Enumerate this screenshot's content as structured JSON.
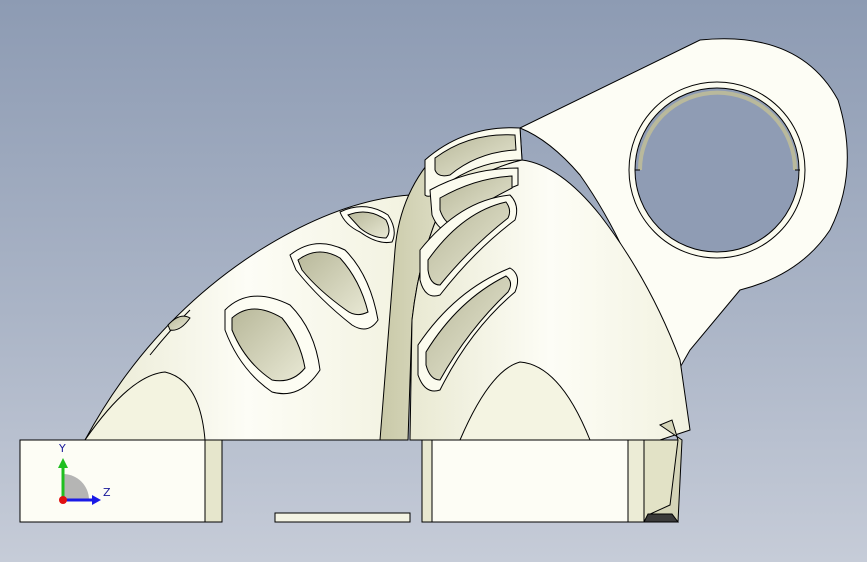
{
  "viewport": {
    "background_top": "#8d9bb3",
    "background_bottom": "#c6ccd8"
  },
  "model": {
    "face_color": "#fdfdf4",
    "shadow_color": "#dcdcc0",
    "edge_color": "#000000"
  },
  "triad": {
    "y_label": "Y",
    "z_label": "Z",
    "y_color": "#1fbf1f",
    "z_color": "#1a1ae6",
    "origin_color": "#e01010"
  }
}
